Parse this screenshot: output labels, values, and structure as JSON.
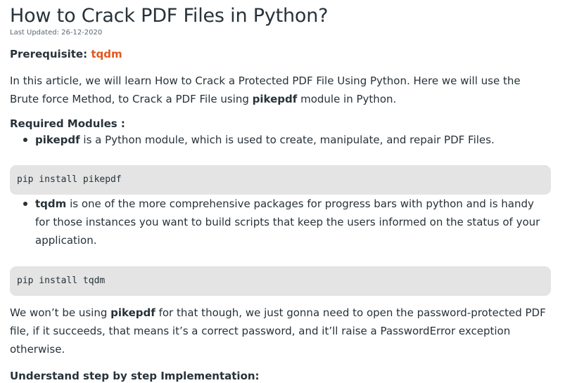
{
  "article": {
    "title": "How to Crack PDF Files in Python?",
    "last_updated": "Last Updated: 26-12-2020",
    "prerequisite_label": "Prerequisite:",
    "prerequisite_link": "tqdm",
    "intro": "In this article, we will learn How to Crack a Protected PDF File Using Python. Here we will use the Brute force Method, to Crack a PDF File using",
    "intro_bold": "pikepdf",
    "intro_end": "module in Python.",
    "required_heading": "Required Modules :",
    "modules": [
      {
        "name": "pikepdf",
        "description": "is a Python module, which is used to create, manipulate, and repair PDF Files.",
        "install": "pip install pikepdf"
      },
      {
        "name": "tqdm",
        "description": "is one of the more comprehensive packages for progress bars with python and is handy for those instances you want to build scripts that keep the users informed on the status of your application.",
        "install": "pip install tqdm"
      }
    ],
    "outro_start": "We won’t be using",
    "outro_bold": "pikepdf",
    "outro_end": "for that though, we just gonna need to open the password-protected PDF file, if it succeeds, that means it’s a correct password, and it’ll raise a PasswordError exception otherwise.",
    "step_heading": "Understand step by step Implementation:"
  },
  "colors": {
    "text": "#273239",
    "link": "#e2571b",
    "code_background": "#e4e4e4",
    "background": "#ffffff"
  }
}
